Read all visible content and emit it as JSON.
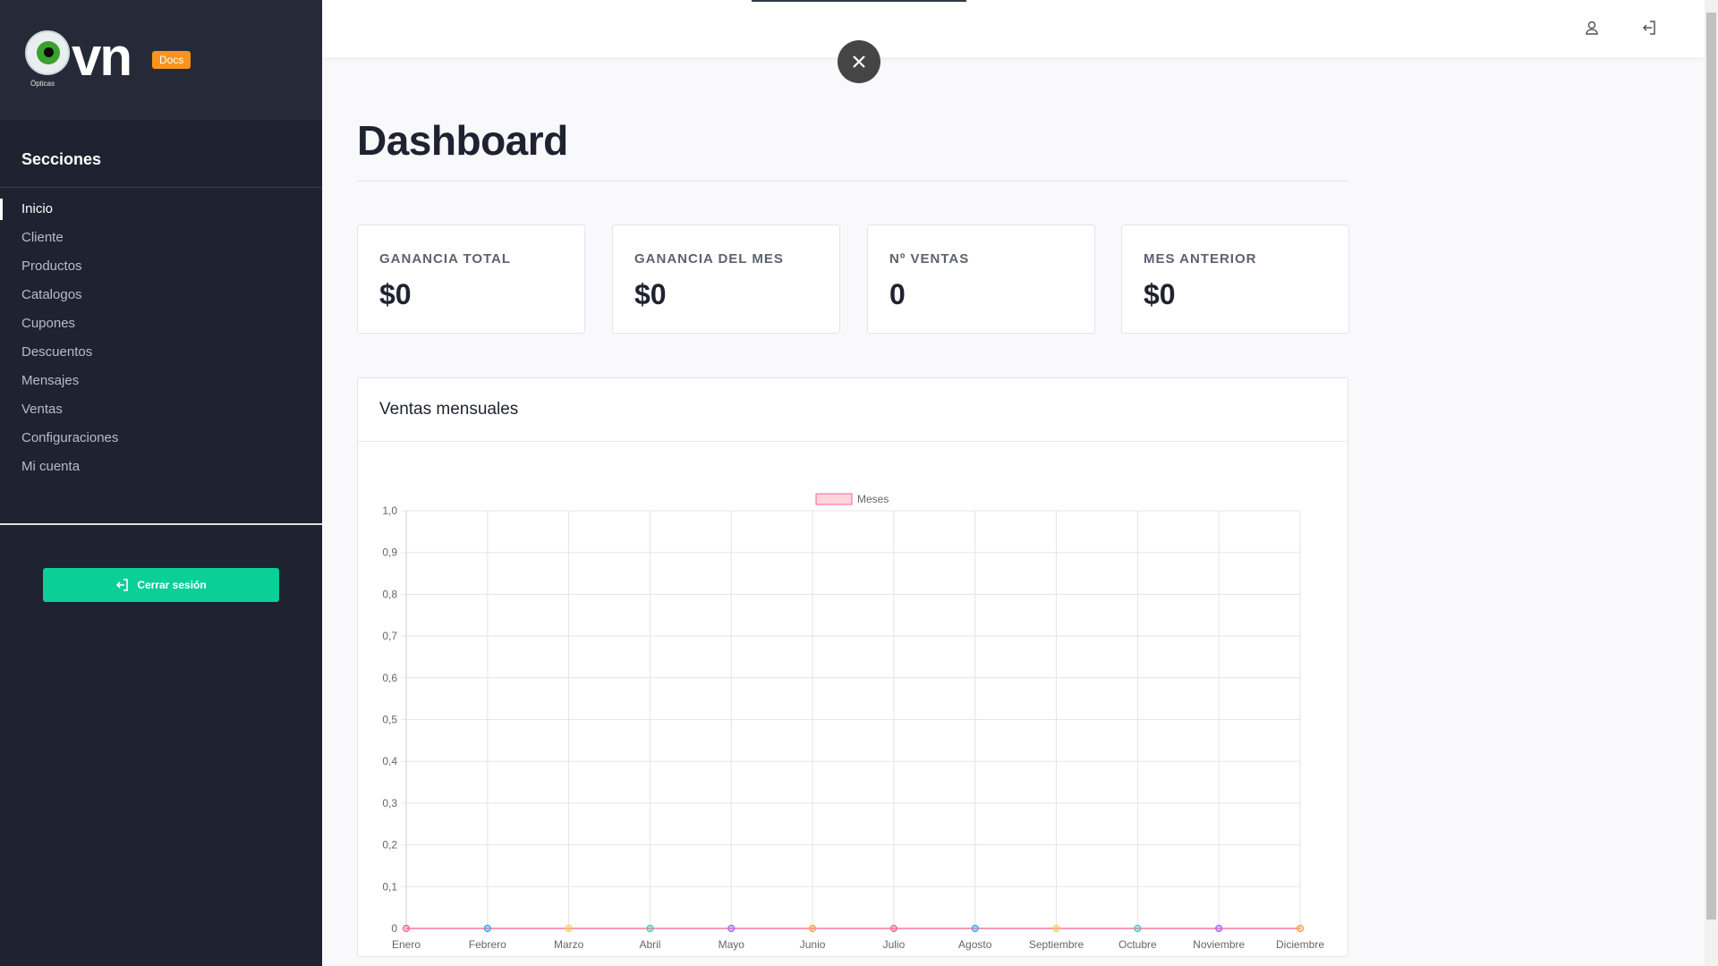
{
  "sidebar": {
    "logo_text": "vn",
    "logo_subtext": "Ópticas",
    "docs_badge": "Docs",
    "section_title": "Secciones",
    "items": [
      {
        "label": "Inicio",
        "active": true
      },
      {
        "label": "Cliente"
      },
      {
        "label": "Productos"
      },
      {
        "label": "Catalogos"
      },
      {
        "label": "Cupones"
      },
      {
        "label": "Descuentos"
      },
      {
        "label": "Mensajes"
      },
      {
        "label": "Ventas"
      },
      {
        "label": "Configuraciones"
      },
      {
        "label": "Mi cuenta"
      }
    ],
    "logout_label": "Cerrar sesión"
  },
  "topbar": {
    "icons": [
      "user-icon",
      "logout-icon"
    ]
  },
  "overlay": {
    "close_icon": "close-icon"
  },
  "main": {
    "title": "Dashboard",
    "cards": [
      {
        "label": "GANANCIA TOTAL",
        "value": "$0"
      },
      {
        "label": "GANANCIA DEL MES",
        "value": "$0"
      },
      {
        "label": "Nº VENTAS",
        "value": "0"
      },
      {
        "label": "MES ANTERIOR",
        "value": "$0"
      }
    ],
    "chart_title": "Ventas mensuales"
  },
  "colors": {
    "sidebar_bg": "#1f2230",
    "accent_green": "#0acf97",
    "docs_orange": "#f7941d",
    "series_line": "#ff6384"
  },
  "chart_data": {
    "type": "line",
    "categories": [
      "Enero",
      "Febrero",
      "Marzo",
      "Abril",
      "Mayo",
      "Junio",
      "Julio",
      "Agosto",
      "Septiembre",
      "Octubre",
      "Noviembre",
      "Diciembre"
    ],
    "series": [
      {
        "name": "Meses",
        "values": [
          0,
          0,
          0,
          0,
          0,
          0,
          0,
          0,
          0,
          0,
          0,
          0
        ]
      }
    ],
    "point_colors": [
      "#ff6384",
      "#36a2eb",
      "#ffce56",
      "#4bc0c0",
      "#9966ff",
      "#ff9f40",
      "#ff6384",
      "#36a2eb",
      "#ffce56",
      "#4bc0c0",
      "#9966ff",
      "#ff9f40"
    ],
    "ylim": [
      0,
      1
    ],
    "yticks": [
      "0",
      "0,1",
      "0,2",
      "0,3",
      "0,4",
      "0,5",
      "0,6",
      "0,7",
      "0,8",
      "0,9",
      "1,0"
    ],
    "legend": "top-center",
    "grid": true,
    "title": "",
    "xlabel": "",
    "ylabel": ""
  }
}
